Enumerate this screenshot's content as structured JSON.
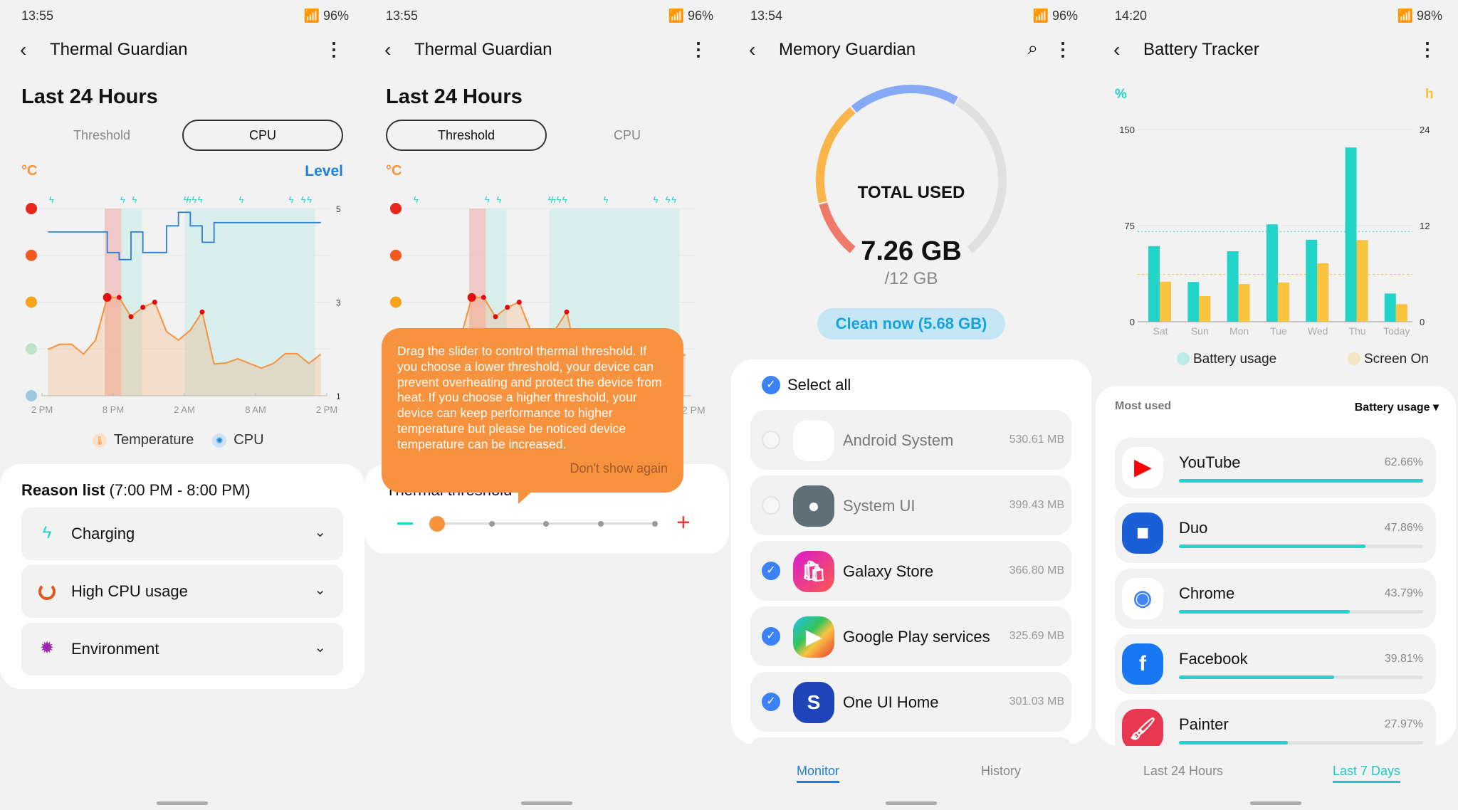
{
  "colors": {
    "teal": "#22d3c8",
    "orange": "#f7923f",
    "blue": "#2b7fd4",
    "yellow": "#f8c440",
    "red": "#e53935"
  },
  "p1": {
    "status": {
      "time": "13:55",
      "battery": "96%"
    },
    "title": "Thermal Guardian",
    "heading": "Last 24 Hours",
    "tabs": [
      {
        "label": "Threshold",
        "selected": false
      },
      {
        "label": "CPU",
        "selected": true
      }
    ],
    "chart_unit_left": "°C",
    "chart_unit_right": "Level",
    "legend": [
      "Temperature",
      "CPU"
    ],
    "reason_title": "Reason list",
    "reason_range": "(7:00 PM - 8:00 PM)",
    "reasons": [
      {
        "label": "Charging",
        "icon": "bolt-icon"
      },
      {
        "label": "High CPU usage",
        "icon": "cpu-ring-icon"
      },
      {
        "label": "Environment",
        "icon": "sun-icon"
      }
    ]
  },
  "p2": {
    "status": {
      "time": "13:55",
      "battery": "96%"
    },
    "title": "Thermal Guardian",
    "heading": "Last 24 Hours",
    "tabs": [
      {
        "label": "Threshold",
        "selected": true
      },
      {
        "label": "CPU",
        "selected": false
      }
    ],
    "chart_unit_left": "°C",
    "x_last_label": "2 PM",
    "tooltip": "Drag the slider to control thermal threshold. If you choose a lower threshold, your device can prevent overheating and protect the device from heat. If you choose a higher threshold, your device can keep performance to higher temperature but please be noticed device temperature can be increased.",
    "dont_show": "Don't show again",
    "threshold_label": "Thermal threshold",
    "slider": {
      "steps": 5,
      "value": 1
    }
  },
  "p3": {
    "status": {
      "time": "13:54",
      "battery": "96%"
    },
    "title": "Memory Guardian",
    "total_label": "TOTAL USED",
    "used": "7.26 GB",
    "total": "/12 GB",
    "used_fraction": 0.605,
    "clean": "Clean now (5.68 GB)",
    "select_all": "Select all",
    "apps": [
      {
        "name": "Android System",
        "size": "530.61 MB",
        "checked": false
      },
      {
        "name": "System UI",
        "size": "399.43 MB",
        "checked": false
      },
      {
        "name": "Galaxy Store",
        "size": "366.80 MB",
        "checked": true
      },
      {
        "name": "Google Play services",
        "size": "325.69 MB",
        "checked": true
      },
      {
        "name": "One UI Home",
        "size": "301.03 MB",
        "checked": true
      }
    ],
    "nav": [
      "Monitor",
      "History"
    ]
  },
  "p4": {
    "status": {
      "time": "14:20",
      "battery": "98%"
    },
    "title": "Battery Tracker",
    "most_used": "Most used",
    "sort": "Battery usage",
    "apps": [
      {
        "name": "YouTube",
        "pct": "62.66%",
        "value": 62.66
      },
      {
        "name": "Duo",
        "pct": "47.86%",
        "value": 47.86
      },
      {
        "name": "Chrome",
        "pct": "43.79%",
        "value": 43.79
      },
      {
        "name": "Facebook",
        "pct": "39.81%",
        "value": 39.81
      },
      {
        "name": "Painter",
        "pct": "27.97%",
        "value": 27.97
      }
    ],
    "nav": [
      "Last 24 Hours",
      "Last 7 Days"
    ]
  },
  "chart_data": [
    {
      "type": "line",
      "title": "",
      "x_ticks": [
        "2 PM",
        "8 PM",
        "2 AM",
        "8 AM",
        "2 PM"
      ],
      "y_left_unit": "°C",
      "y_left_levels": [
        "very-hot-face",
        "hot-face",
        "warm-face",
        "normal-face",
        "cool-face"
      ],
      "y_right_unit": "Level",
      "y_right_ticks": [
        "5",
        "3",
        "1"
      ],
      "ylim": [
        1,
        5
      ],
      "series": [
        {
          "name": "Temperature",
          "color": "#f7923f",
          "points": [
            [
              "14:30",
              1.99
            ],
            [
              "15:30",
              2.1
            ],
            [
              "16:30",
              2.1
            ],
            [
              "17:30",
              1.89
            ],
            [
              "18:30",
              2.18
            ],
            [
              "19:30",
              3.1
            ],
            [
              "20:30",
              3.1
            ],
            [
              "21:30",
              2.69
            ],
            [
              "22:30",
              2.89
            ],
            [
              "23:30",
              3.0
            ],
            [
              "00:30",
              2.37
            ],
            [
              "01:30",
              2.19
            ],
            [
              "02:30",
              2.4
            ],
            [
              "03:30",
              2.79
            ],
            [
              "04:30",
              1.68
            ],
            [
              "05:30",
              1.7
            ],
            [
              "06:30",
              1.79
            ],
            [
              "07:30",
              1.69
            ],
            [
              "08:30",
              1.59
            ],
            [
              "09:30",
              1.69
            ],
            [
              "10:30",
              1.9
            ],
            [
              "11:30",
              1.9
            ],
            [
              "12:30",
              1.69
            ],
            [
              "13:30",
              1.89
            ]
          ],
          "hot_points": [
            "19:30",
            "20:30",
            "21:30",
            "22:30",
            "23:30",
            "03:30"
          ]
        },
        {
          "name": "CPU",
          "color": "#2b7fd4",
          "step": true,
          "points": [
            [
              "14:30",
              4.5
            ],
            [
              "19:30",
              4.06
            ],
            [
              "20:30",
              3.91
            ],
            [
              "21:30",
              4.5
            ],
            [
              "22:30",
              4.06
            ],
            [
              "00:30",
              4.63
            ],
            [
              "01:30",
              4.92
            ],
            [
              "02:30",
              4.63
            ],
            [
              "03:30",
              4.28
            ],
            [
              "04:30",
              4.7
            ],
            [
              "13:30",
              4.7
            ]
          ]
        }
      ],
      "charging_marks": [
        "14:48",
        "20:48",
        "21:48",
        "02:08",
        "02:23",
        "02:50",
        "03:20",
        "06:48",
        "11:00",
        "12:02",
        "12:32"
      ],
      "overheat_band": [
        "19:17",
        "20:41"
      ],
      "charging_bands": [
        [
          "20:41",
          "22:26"
        ],
        [
          "02:02",
          "13:02"
        ]
      ]
    },
    {
      "type": "bar",
      "title": "",
      "categories": [
        "Sat",
        "Sun",
        "Mon",
        "Tue",
        "Wed",
        "Thu",
        "Today"
      ],
      "y_left_unit": "%",
      "y_left_ticks": [
        0,
        75,
        150
      ],
      "y_right_unit": "h",
      "y_right_ticks": [
        0,
        12,
        24
      ],
      "series": [
        {
          "name": "Battery usage",
          "axis": "left",
          "color": "#22d3c8",
          "values": [
            59,
            31,
            55,
            76,
            64,
            136,
            22
          ],
          "average": 70.4
        },
        {
          "name": "Screen On",
          "axis": "right",
          "color": "#f8c440",
          "values": [
            5.0,
            3.2,
            4.7,
            4.9,
            7.3,
            10.2,
            2.2
          ],
          "average": 5.9
        }
      ],
      "legend": "bottom"
    }
  ]
}
